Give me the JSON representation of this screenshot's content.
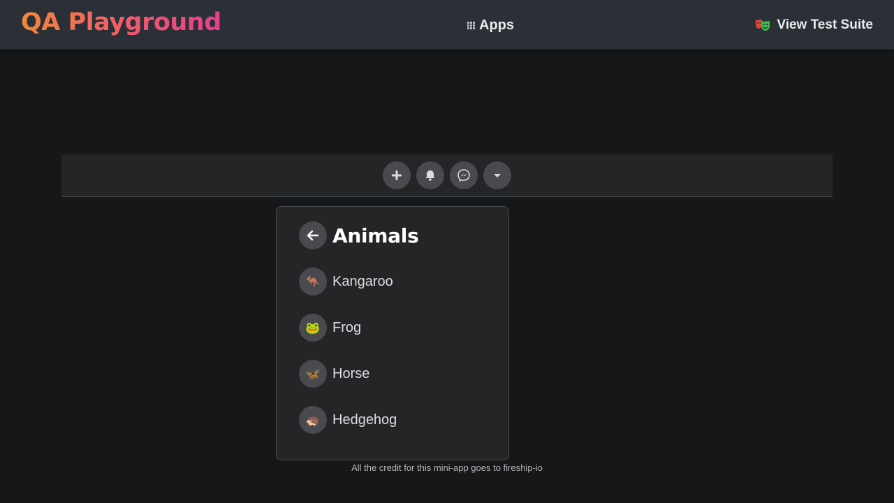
{
  "header": {
    "brand": "QA Playground",
    "apps_link": "Apps",
    "apps_icon": "grid-icon",
    "suite_link": "View Test Suite",
    "suite_icon": "theater-masks-icon"
  },
  "navbar": {
    "buttons": [
      {
        "icon": "plus-icon"
      },
      {
        "icon": "bell-icon"
      },
      {
        "icon": "messenger-icon"
      },
      {
        "icon": "caret-down-icon"
      }
    ]
  },
  "dropdown": {
    "title": "Animals",
    "back_icon": "arrow-left-icon",
    "items": [
      {
        "label": "Kangaroo",
        "icon": "🦘"
      },
      {
        "label": "Frog",
        "icon": "🐸"
      },
      {
        "label": "Horse",
        "icon": "🦋"
      },
      {
        "label": "Hedgehog",
        "icon": "🦔"
      }
    ]
  },
  "footer": {
    "credit": "All the credit for this mini-app goes to fireship-io"
  },
  "colors": {
    "background": "#151718",
    "topbar": "#2b2f36",
    "panel": "#242526",
    "icon_button": "#484a4d",
    "brand_gradient_start": "#f1883d",
    "brand_gradient_end": "#e83e8c"
  }
}
